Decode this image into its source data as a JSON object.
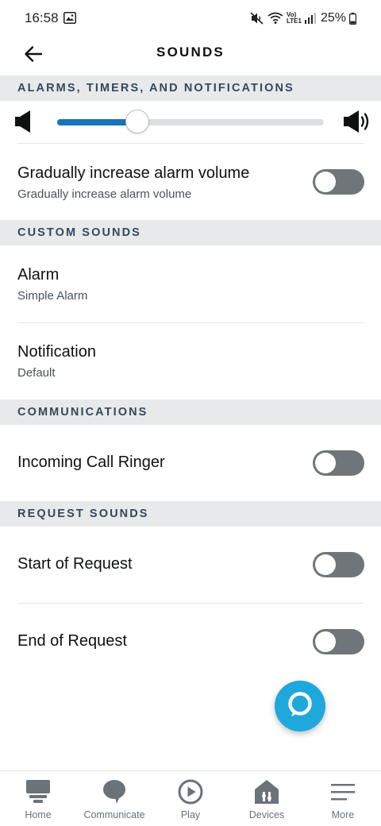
{
  "status_bar": {
    "time": "16:58",
    "image_icon": "image-icon",
    "mute_icon": "mute-icon",
    "wifi_icon": "wifi-icon",
    "network_label_top": "Vo)",
    "network_label_bottom": "LTE1",
    "signal_icon": "signal-icon",
    "battery_percent": "25%",
    "battery_level": 0.25
  },
  "header": {
    "title": "SOUNDS",
    "back_icon": "back-arrow-icon"
  },
  "sections": {
    "alarms": "ALARMS, TIMERS, AND NOTIFICATIONS",
    "custom": "CUSTOM SOUNDS",
    "communications": "COMMUNICATIONS",
    "request": "REQUEST SOUNDS"
  },
  "volume": {
    "level_fraction": 0.3,
    "low_icon": "volume-low-icon",
    "high_icon": "volume-high-icon",
    "fill_color": "#1a73b8"
  },
  "settings": {
    "gradual": {
      "title": "Gradually increase alarm volume",
      "subtitle": "Gradually increase alarm volume",
      "enabled": false
    },
    "alarm": {
      "title": "Alarm",
      "subtitle": "Simple Alarm"
    },
    "notification": {
      "title": "Notification",
      "subtitle": "Default"
    },
    "incoming_call": {
      "title": "Incoming Call Ringer",
      "enabled": false
    },
    "start_request": {
      "title": "Start of Request",
      "enabled": false
    },
    "end_request": {
      "title": "End of Request",
      "enabled": false
    }
  },
  "alexa_button": {
    "icon": "alexa-ring-icon",
    "color": "#1fa8dc"
  },
  "bottom_nav": {
    "items": [
      {
        "label": "Home",
        "icon": "home-icon"
      },
      {
        "label": "Communicate",
        "icon": "chat-bubble-icon"
      },
      {
        "label": "Play",
        "icon": "play-icon"
      },
      {
        "label": "Devices",
        "icon": "devices-icon"
      },
      {
        "label": "More",
        "icon": "menu-icon"
      }
    ]
  }
}
